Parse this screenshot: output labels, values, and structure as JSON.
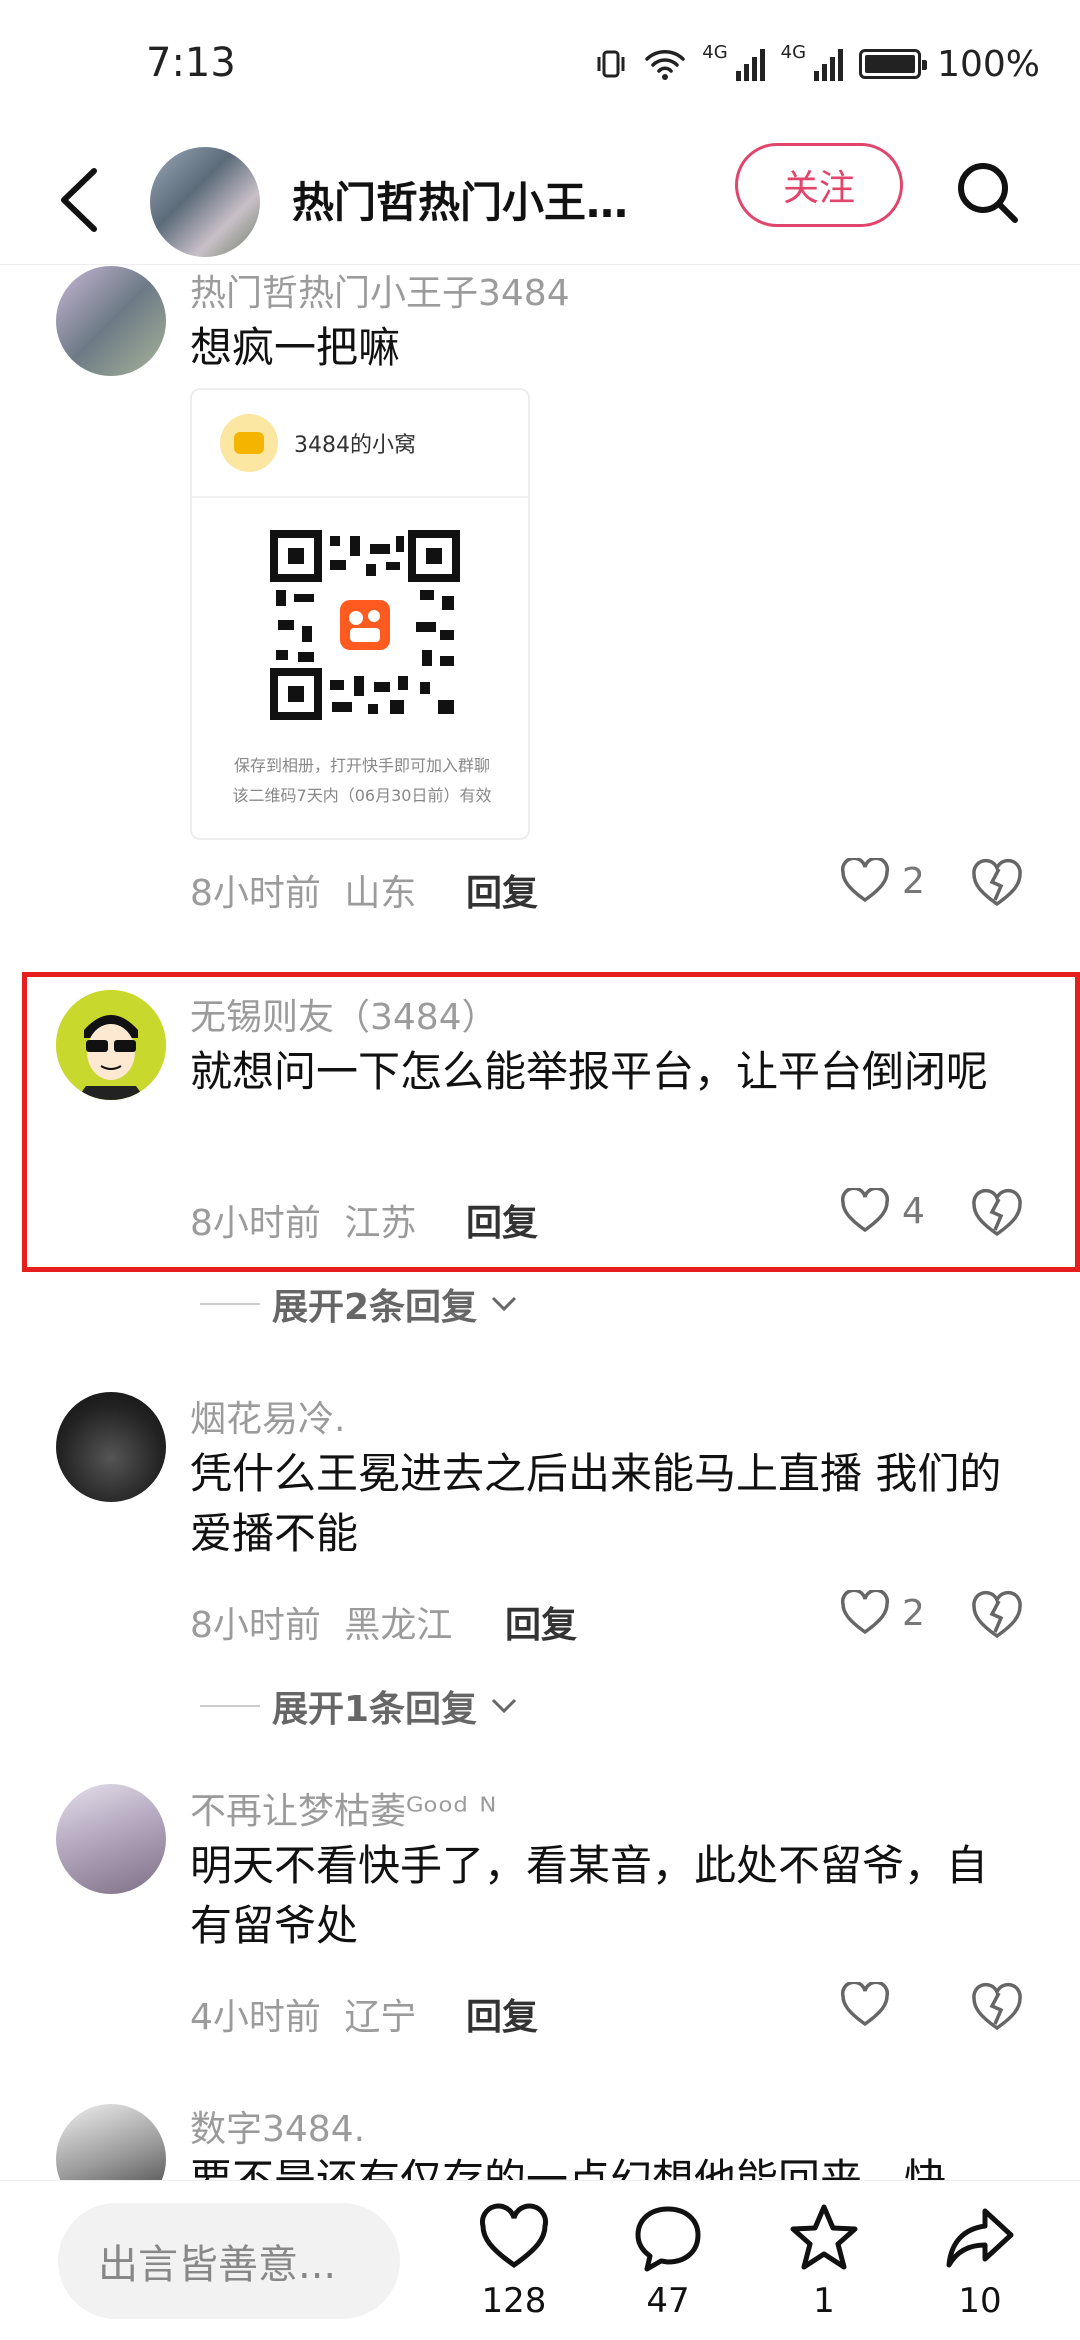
{
  "status_bar": {
    "time": "7:13",
    "network_1": "4G",
    "network_2": "4G",
    "battery": "100%"
  },
  "header": {
    "title": "热门哲热门小王…",
    "follow_label": "关注"
  },
  "comments": [
    {
      "author": "热门哲热门小王子3484",
      "text": "想疯一把嘛",
      "qr_card": {
        "title": "3484的小窝",
        "note_line1": "保存到相册，打开快手即可加入群聊",
        "note_line2": "该二维码7天内（06月30日前）有效"
      },
      "time": "8小时前",
      "location": "山东",
      "reply_label": "回复",
      "likes": "2"
    },
    {
      "author": "无锡则友（3484）",
      "text": "就想问一下怎么能举报平台，让平台倒闭呢",
      "time": "8小时前",
      "location": "江苏",
      "reply_label": "回复",
      "likes": "4",
      "expand_label": "展开2条回复"
    },
    {
      "author": "烟花易冷.",
      "text": "凭什么王冕进去之后出来能马上直播 我们的爱播不能",
      "time": "8小时前",
      "location": "黑龙江",
      "reply_label": "回复",
      "likes": "2",
      "expand_label": "展开1条回复"
    },
    {
      "author": "不再让梦枯萎ᴳᵒᵒᵈ ᴺ",
      "text": "明天不看快手了，看某音，此处不留爷，自有留爷处",
      "time": "4小时前",
      "location": "辽宁",
      "reply_label": "回复",
      "likes": ""
    },
    {
      "author": "数字3484.",
      "text": "要不是还有仅存的一点幻想他能回来，快"
    }
  ],
  "bottom_bar": {
    "input_placeholder": "出言皆善意...",
    "likes": "128",
    "comments": "47",
    "favorites": "1",
    "shares": "10"
  },
  "colors": {
    "accent": "#e2456b",
    "highlight": "#e61e1e"
  }
}
